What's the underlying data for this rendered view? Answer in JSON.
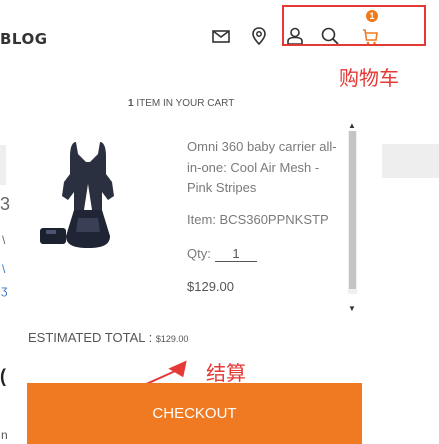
{
  "header": {
    "brand_fragment": "BLOG",
    "icons": [
      "mail-icon",
      "location-icon",
      "user-icon",
      "search-icon",
      "cart-icon"
    ],
    "cart_badge": "1"
  },
  "annotations": {
    "cart_label": "购物车",
    "checkout_label": "结算",
    "highlight_color": "#e53935"
  },
  "cart": {
    "item_count_number": "1",
    "item_count_text": " ITEM IN YOUR CART",
    "product": {
      "name": "Omni 360 baby carrier all-in-one: Cool Air Mesh - Pink Stripes",
      "sku": "Item: BCS360PPNKSTP",
      "qty_label": "Qty:",
      "qty": "1",
      "price": "$129.00"
    },
    "estimated_total_label": "ESTIMATED TOTAL : ",
    "estimated_total_value": "$129.00",
    "checkout_label": "CHECKOUT",
    "accent_color": "#f07a22"
  },
  "background_fragments": {
    "f1": "3",
    "f2": "\\",
    "f3": "\\",
    "f4": "ʒ",
    "f5": "(",
    "f6": "n"
  }
}
